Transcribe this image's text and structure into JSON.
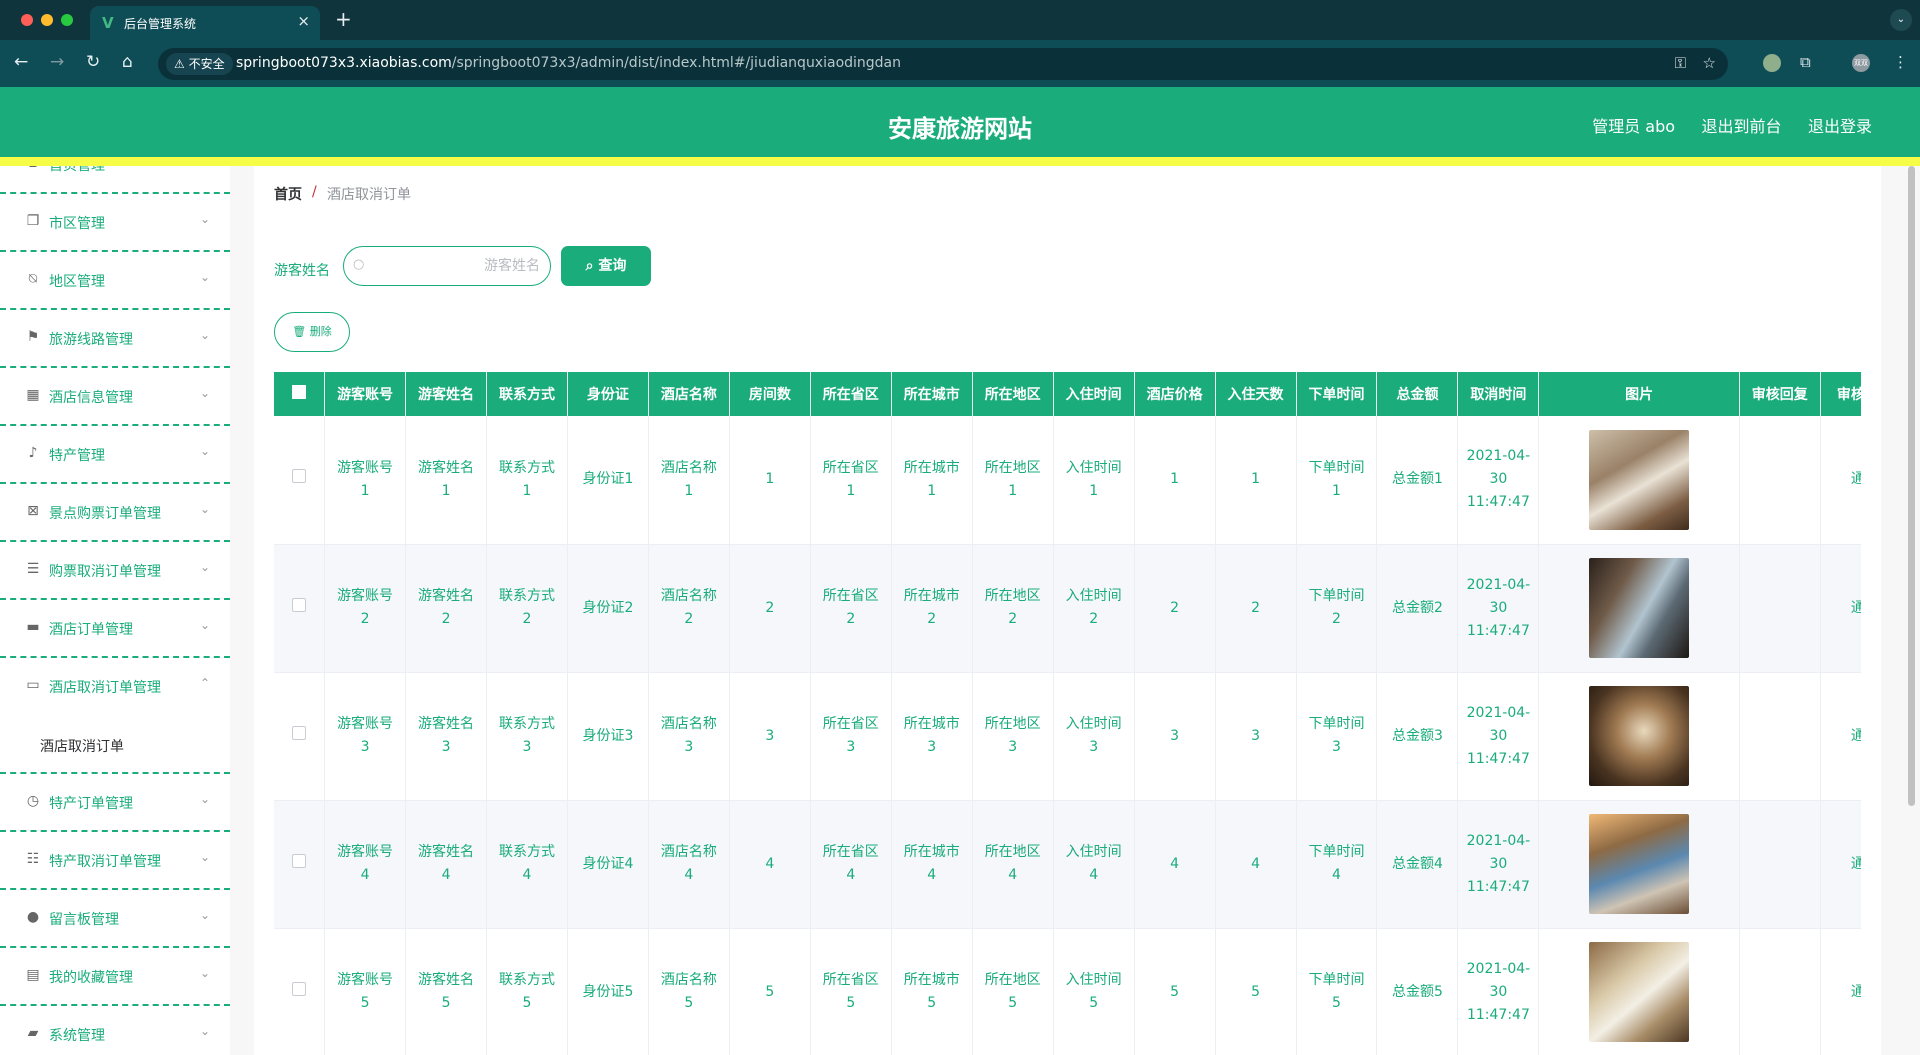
{
  "browser": {
    "tab_title": "后台管理系统",
    "tab_logo": "V",
    "insecure_label": "不安全",
    "url_domain": "springboot073x3.xiaobias.com",
    "url_path": "/springboot073x3/admin/dist/index.html#/jiudianquxiaodingdan",
    "profile_label": "双双"
  },
  "header": {
    "title": "安康旅游网站",
    "admin_label": "管理员 abo",
    "front_link": "退出到前台",
    "logout_link": "退出登录"
  },
  "sidebar": {
    "items": [
      {
        "label": "首页管理",
        "icon": "home-icon"
      },
      {
        "label": "市区管理",
        "icon": "copy-icon"
      },
      {
        "label": "地区管理",
        "icon": "bell-off-icon"
      },
      {
        "label": "旅游线路管理",
        "icon": "flag-icon"
      },
      {
        "label": "酒店信息管理",
        "icon": "grid-icon"
      },
      {
        "label": "特产管理",
        "icon": "microphone-icon"
      },
      {
        "label": "景点购票订单管理",
        "icon": "clipboard-x-icon"
      },
      {
        "label": "购票取消订单管理",
        "icon": "list-icon"
      },
      {
        "label": "酒店订单管理",
        "icon": "monitor-icon"
      },
      {
        "label": "酒店取消订单管理",
        "icon": "printer-icon"
      },
      {
        "label": "特产订单管理",
        "icon": "clock-icon"
      },
      {
        "label": "特产取消订单管理",
        "icon": "sliders-icon"
      },
      {
        "label": "留言板管理",
        "icon": "location-icon"
      },
      {
        "label": "我的收藏管理",
        "icon": "document-icon"
      },
      {
        "label": "系统管理",
        "icon": "ticket-icon"
      }
    ],
    "submenu_label": "酒店取消订单"
  },
  "breadcrumb": {
    "home": "首页",
    "separator": "/",
    "current": "酒店取消订单"
  },
  "search": {
    "label": "游客姓名",
    "placeholder": "游客姓名",
    "query_button": "查询",
    "delete_button": "删除"
  },
  "table": {
    "headers": [
      "游客账号",
      "游客姓名",
      "联系方式",
      "身份证",
      "酒店名称",
      "房间数",
      "所在省区",
      "所在城市",
      "所在地区",
      "入住时间",
      "酒店价格",
      "入住天数",
      "下单时间",
      "总金额",
      "取消时间",
      "图片",
      "审核回复",
      "审核状态"
    ],
    "rows": [
      [
        "游客账号1",
        "游客姓名1",
        "联系方式1",
        "身份证1",
        "酒店名称1",
        "1",
        "所在省区1",
        "所在城市1",
        "所在地区1",
        "入住时间1",
        "1",
        "1",
        "下单时间1",
        "总金额1",
        "2021-04-30 11:47:47",
        "",
        "",
        "通过"
      ],
      [
        "游客账号2",
        "游客姓名2",
        "联系方式2",
        "身份证2",
        "酒店名称2",
        "2",
        "所在省区2",
        "所在城市2",
        "所在地区2",
        "入住时间2",
        "2",
        "2",
        "下单时间2",
        "总金额2",
        "2021-04-30 11:47:47",
        "",
        "",
        "通过"
      ],
      [
        "游客账号3",
        "游客姓名3",
        "联系方式3",
        "身份证3",
        "酒店名称3",
        "3",
        "所在省区3",
        "所在城市3",
        "所在地区3",
        "入住时间3",
        "3",
        "3",
        "下单时间3",
        "总金额3",
        "2021-04-30 11:47:47",
        "",
        "",
        "通过"
      ],
      [
        "游客账号4",
        "游客姓名4",
        "联系方式4",
        "身份证4",
        "酒店名称4",
        "4",
        "所在省区4",
        "所在城市4",
        "所在地区4",
        "入住时间4",
        "4",
        "4",
        "下单时间4",
        "总金额4",
        "2021-04-30 11:47:47",
        "",
        "",
        "通过"
      ],
      [
        "游客账号5",
        "游客姓名5",
        "联系方式5",
        "身份证5",
        "酒店名称5",
        "5",
        "所在省区5",
        "所在城市5",
        "所在地区5",
        "入住时间5",
        "5",
        "5",
        "下单时间5",
        "总金额5",
        "2021-04-30 11:47:47",
        "",
        "",
        "通过"
      ]
    ]
  },
  "colors": {
    "primary": "#1aac7b",
    "accent_strip": "#f6fd47",
    "browser_tabbar": "#10343c",
    "browser_toolbar": "#0f4d56"
  }
}
